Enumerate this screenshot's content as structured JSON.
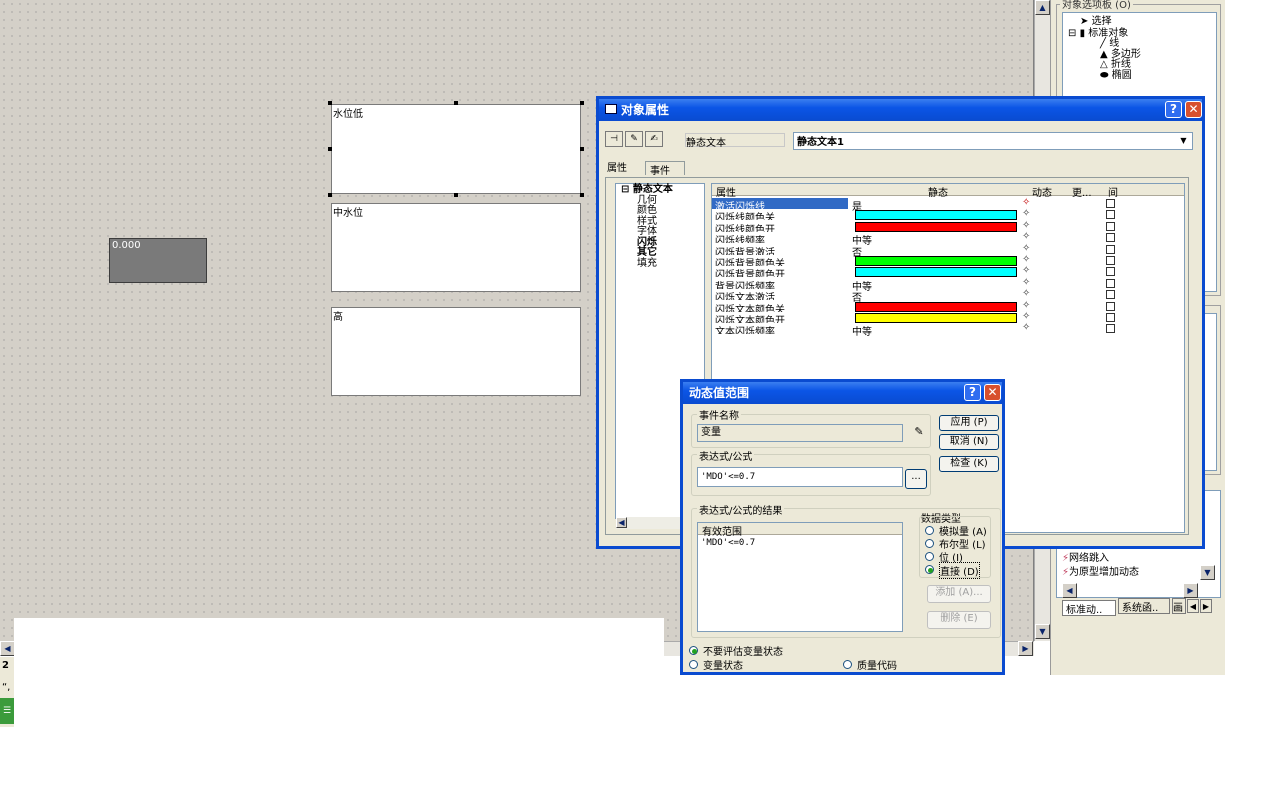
{
  "canvas": {
    "boxes": [
      {
        "label": "水位低"
      },
      {
        "label": "中水位"
      },
      {
        "label": "高"
      }
    ],
    "io_field_value": "0.000"
  },
  "right_panel": {
    "palette_title": "对象选项板 (O)",
    "tree": [
      "选择",
      "标准对象",
      "线",
      "多边形",
      "折线",
      "椭圆"
    ],
    "bottom_list": [
      "网络跳入",
      "为原型增加动态"
    ],
    "tabs": [
      "标准动..",
      "系统函..",
      "画"
    ]
  },
  "statusbar": {
    "line1": "2",
    "line2": "“,"
  },
  "props_window": {
    "title": "对象属性",
    "object_type": "静态文本",
    "object_name": "静态文本1",
    "tabs": [
      "属性",
      "事件"
    ],
    "tree_root": "静态文本",
    "tree_items": [
      "几何",
      "颜色",
      "样式",
      "字体",
      "闪烁",
      "其它",
      "填充"
    ],
    "columns": [
      "属性",
      "静态",
      "动态",
      "更...",
      "间"
    ],
    "rows": [
      {
        "name": "激活闪烁线",
        "static": "是",
        "color": ""
      },
      {
        "name": "闪烁线颜色关",
        "static": "",
        "color": "#00ffff"
      },
      {
        "name": "闪烁线颜色开",
        "static": "",
        "color": "#ff0000"
      },
      {
        "name": "闪烁线频率",
        "static": "中等",
        "color": ""
      },
      {
        "name": "闪烁背景激活",
        "static": "否",
        "color": ""
      },
      {
        "name": "闪烁背景颜色关",
        "static": "",
        "color": "#00ff00"
      },
      {
        "name": "闪烁背景颜色开",
        "static": "",
        "color": "#00ffff"
      },
      {
        "name": "背景闪烁频率",
        "static": "中等",
        "color": ""
      },
      {
        "name": "闪烁文本激活",
        "static": "否",
        "color": ""
      },
      {
        "name": "闪烁文本颜色关",
        "static": "",
        "color": "#ff0000"
      },
      {
        "name": "闪烁文本颜色开",
        "static": "",
        "color": "#ffff00"
      },
      {
        "name": "文本闪烁频率",
        "static": "中等",
        "color": ""
      }
    ]
  },
  "dyn_dialog": {
    "title": "动态值范围",
    "event_label": "事件名称",
    "event_value": "变量",
    "expr_label": "表达式/公式",
    "expr_value": "'MDO'<=0.7",
    "browse_label": "...",
    "result_label": "表达式/公式的结果",
    "result_header": "有效范围",
    "result_row": "'MDO'<=0.7",
    "buttons": {
      "apply": "应用 (P)",
      "cancel": "取消 (N)",
      "check": "检查 (K)",
      "add": "添加 (A)...",
      "delete": "删除 (E)"
    },
    "datatype_label": "数据类型",
    "datatypes": [
      "模拟量 (A)",
      "布尔型 (L)",
      "位 (I)",
      "直接 (D)"
    ],
    "radio_bottom": [
      "不要评估变量状态",
      "变量状态",
      "质量代码"
    ]
  }
}
